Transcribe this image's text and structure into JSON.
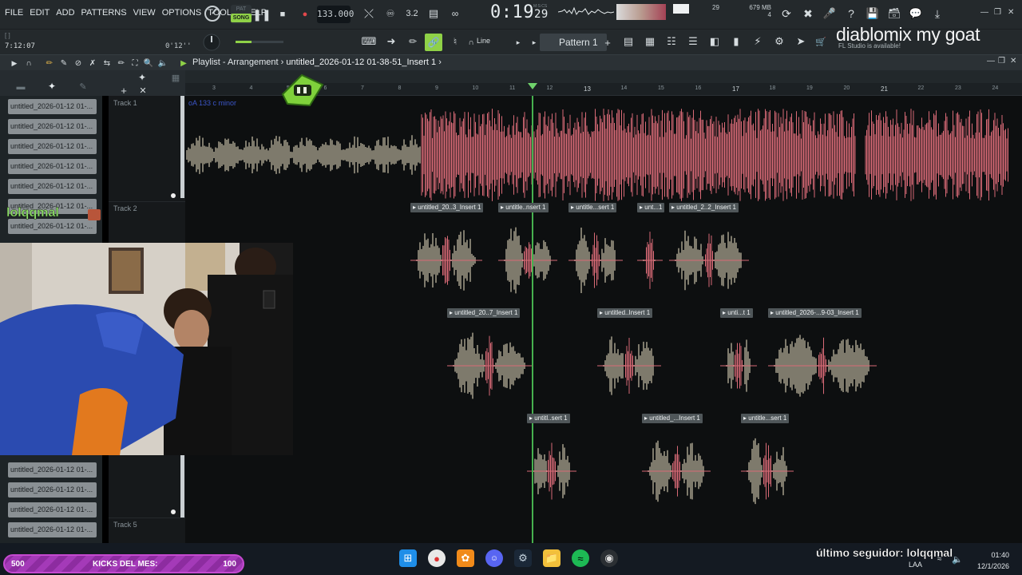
{
  "menu": [
    "FILE",
    "EDIT",
    "ADD",
    "PATTERNS",
    "VIEW",
    "OPTIONS",
    "TOOLS",
    "HELP"
  ],
  "transport": {
    "pat_label": "PAT",
    "song_label": "SONG",
    "tempo": "133.000",
    "time_main": "0:19",
    "time_sub": "29",
    "time_unit_label": "M:S:CS",
    "memory": "679 MB",
    "cpu_cores": "4",
    "polyphony": "29"
  },
  "toolbar2": {
    "hint": "[  ]",
    "clock_small": "7:12:07",
    "clock_right": "0'12''",
    "line_mode": "Line",
    "pattern": "Pattern 1",
    "update_note": "FL Studio is available!"
  },
  "overlay_title": "diablomix my goat",
  "playlist": {
    "title_prefix": "Playlist - Arrangement",
    "title_sep": "›",
    "title_name": "untitled_2026-01-12 01-38-51_Insert 1",
    "key_label": "oA 133 c minor"
  },
  "ruler": [
    "3",
    "4",
    "5",
    "6",
    "7",
    "8",
    "9",
    "10",
    "11",
    "12",
    "13",
    "14",
    "15",
    "16",
    "17",
    "18",
    "19",
    "20",
    "21",
    "22",
    "23",
    "24"
  ],
  "ruler_major": [
    "13",
    "17",
    "21"
  ],
  "picker_items": [
    "untitled_2026-01-12 01-...",
    "untitled_2026-01-12 01-...",
    "untitled_2026-01-12 01-...",
    "untitled_2026-01-12 01-...",
    "untitled_2026-01-12 01-...",
    "untitled_2026-01-12 01-...",
    "untitled_2026-01-12 01-...",
    "untitled_2026-01-12 01-...",
    "untitled_2026-01-12 01-...",
    "untitled_2026-01-12 01-...",
    "untitled_2026-01-12 01-..."
  ],
  "tracks": [
    "Track 1",
    "Track 2",
    "Track 5"
  ],
  "clips_row2": [
    "untitled_20..3_Insert 1",
    "untitle..nsert 1",
    "untitle...sert 1",
    "unt...1",
    "untitled_2..2_Insert 1"
  ],
  "clips_row3": [
    "untitled_20..7_Insert 1",
    "untitled..Insert 1",
    "unti...t 1",
    "untitled_2026-...9-03_Insert 1"
  ],
  "clips_row4": [
    "untitl..sert 1",
    "untitled_...Insert 1",
    "untitle...sert 1"
  ],
  "chat_name": "lolqqmal",
  "bottom": {
    "kicks_left": "500",
    "kicks_label": "KICKS DEL MES:",
    "kicks_right": "100",
    "follower": "último seguidor: lolqqmal",
    "lang": "LAA",
    "time": "01:40",
    "date": "12/1/2026"
  },
  "colors": {
    "accent_green": "#8fd147",
    "playhead": "#46b04f",
    "waveform_light": "#f0e6c8",
    "waveform_red": "#d86a76",
    "kicks_purple": "#a43ab8"
  }
}
